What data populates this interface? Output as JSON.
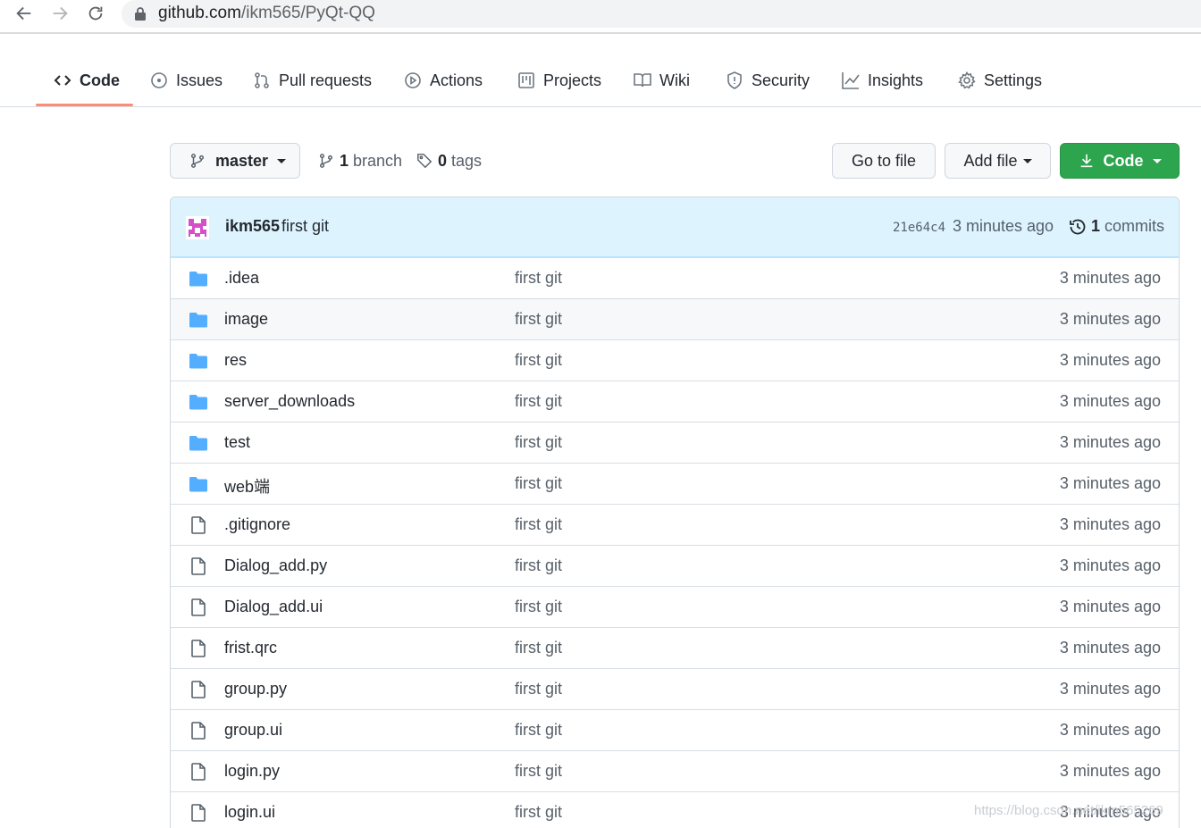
{
  "browser": {
    "url_host": "github.com",
    "url_path": "/ikm565/PyQt-QQ"
  },
  "repo_nav": {
    "tabs": [
      {
        "label": "Code",
        "icon": "code-icon",
        "selected": true
      },
      {
        "label": "Issues",
        "icon": "issue-opened-icon"
      },
      {
        "label": "Pull requests",
        "icon": "git-pull-request-icon"
      },
      {
        "label": "Actions",
        "icon": "play-icon"
      },
      {
        "label": "Projects",
        "icon": "project-board-icon"
      },
      {
        "label": "Wiki",
        "icon": "book-icon"
      },
      {
        "label": "Security",
        "icon": "shield-icon"
      },
      {
        "label": "Insights",
        "icon": "graph-icon"
      },
      {
        "label": "Settings",
        "icon": "gear-icon"
      }
    ],
    "accent": "#fd8c73"
  },
  "toolbar": {
    "branch_button": "master",
    "branch_count": "1",
    "branch_label": "branch",
    "tag_count": "0",
    "tag_label": "tags",
    "goto_file": "Go to file",
    "add_file": "Add file",
    "code_button": "Code",
    "code_button_color": "#2da44e"
  },
  "latest_commit": {
    "author": "ikm565",
    "message": "first git",
    "sha": "21e64c4",
    "time": "3 minutes ago",
    "count": "1",
    "count_label": "commits"
  },
  "files": [
    {
      "type": "dir",
      "name": ".idea",
      "message": "first git",
      "age": "3 minutes ago"
    },
    {
      "type": "dir",
      "name": "image",
      "message": "first git",
      "age": "3 minutes ago"
    },
    {
      "type": "dir",
      "name": "res",
      "message": "first git",
      "age": "3 minutes ago"
    },
    {
      "type": "dir",
      "name": "server_downloads",
      "message": "first git",
      "age": "3 minutes ago"
    },
    {
      "type": "dir",
      "name": "test",
      "message": "first git",
      "age": "3 minutes ago"
    },
    {
      "type": "dir",
      "name": "web端",
      "message": "first git",
      "age": "3 minutes ago"
    },
    {
      "type": "file",
      "name": ".gitignore",
      "message": "first git",
      "age": "3 minutes ago"
    },
    {
      "type": "file",
      "name": "Dialog_add.py",
      "message": "first git",
      "age": "3 minutes ago"
    },
    {
      "type": "file",
      "name": "Dialog_add.ui",
      "message": "first git",
      "age": "3 minutes ago"
    },
    {
      "type": "file",
      "name": "frist.qrc",
      "message": "first git",
      "age": "3 minutes ago"
    },
    {
      "type": "file",
      "name": "group.py",
      "message": "first git",
      "age": "3 minutes ago"
    },
    {
      "type": "file",
      "name": "group.ui",
      "message": "first git",
      "age": "3 minutes ago"
    },
    {
      "type": "file",
      "name": "login.py",
      "message": "first git",
      "age": "3 minutes ago"
    },
    {
      "type": "file",
      "name": "login.ui",
      "message": "first git",
      "age": "3 minutes ago"
    }
  ],
  "watermark": "https://blog.csdn.net/ikm565269"
}
